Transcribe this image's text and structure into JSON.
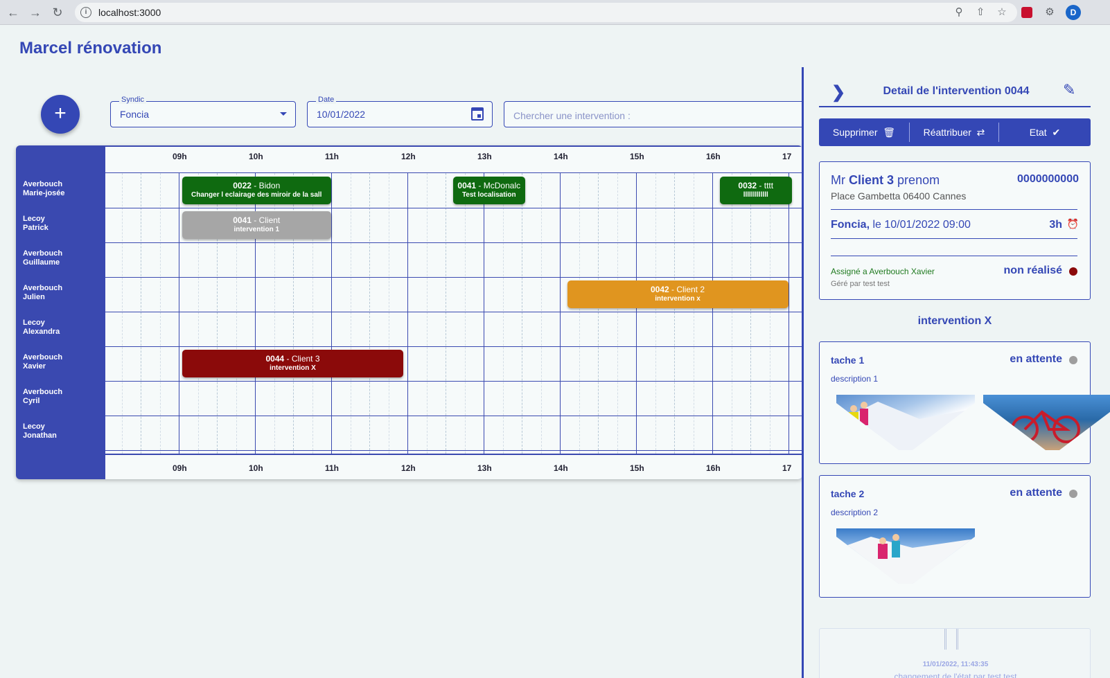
{
  "browser": {
    "url": "localhost:3000",
    "profile_initial": "D"
  },
  "app": {
    "title": "Marcel rénovation"
  },
  "filters": {
    "syndic_label": "Syndic",
    "syndic_value": "Foncia",
    "date_label": "Date",
    "date_value": "10/01/2022",
    "search_placeholder": "Chercher une intervention :"
  },
  "planning": {
    "hours": [
      "09h",
      "10h",
      "11h",
      "12h",
      "13h",
      "14h",
      "15h",
      "16h",
      "17"
    ],
    "rows": [
      {
        "last": "Averbouch",
        "first": "Marie-josée"
      },
      {
        "last": "Lecoy",
        "first": "Patrick"
      },
      {
        "last": "Averbouch",
        "first": "Guillaume"
      },
      {
        "last": "Averbouch",
        "first": "Julien"
      },
      {
        "last": "Lecoy",
        "first": "Alexandra"
      },
      {
        "last": "Averbouch",
        "first": "Xavier"
      },
      {
        "last": "Averbouch",
        "first": "Cyril"
      },
      {
        "last": "Lecoy",
        "first": "Jonathan"
      }
    ],
    "events": [
      {
        "num": "0022",
        "client": "Bidon",
        "desc": "Changer l eclairage des miroir de la sall",
        "row": 0,
        "start": 9.0,
        "end": 10.95,
        "color": "#0f6a10"
      },
      {
        "num": "0041",
        "client": "McDonalc",
        "desc": "Test localisation",
        "row": 0,
        "start": 12.55,
        "end": 13.5,
        "color": "#0f6a10"
      },
      {
        "num": "0032",
        "client": "tttt",
        "desc": "lllllllllllll",
        "row": 0,
        "start": 16.05,
        "end": 17.0,
        "color": "#0f6a10"
      },
      {
        "num": "0041",
        "client": "Client",
        "desc": "intervention 1",
        "row": 1,
        "start": 9.0,
        "end": 10.95,
        "color": "#a6a6a6"
      },
      {
        "num": "0042",
        "client": "Client 2",
        "desc": "intervention x",
        "row": 3,
        "start": 14.05,
        "end": 16.95,
        "color": "#e0951f"
      },
      {
        "num": "0044",
        "client": "Client 3",
        "desc": "intervention X",
        "row": 5,
        "start": 9.0,
        "end": 11.9,
        "color": "#8b0a0a"
      }
    ]
  },
  "panel": {
    "title": "Detail de l'intervention 0044",
    "actions": {
      "delete": "Supprimer",
      "reassign": "Réattribuer",
      "state": "Etat"
    },
    "client": {
      "civility": "Mr",
      "name": "Client 3",
      "firstname": "prenom",
      "phone": "0000000000",
      "address": "Place Gambetta 06400 Cannes",
      "syndic": "Foncia,",
      "date_text": "le 10/01/2022 09:00",
      "duration": "3h",
      "assigned": "Assigné a Averbouch Xavier",
      "managed_by": "Géré par test test",
      "status": "non réalisé",
      "status_color": "#8b0a0a"
    },
    "intervention_title": "intervention X",
    "tasks": [
      {
        "name": "tache 1",
        "state": "en attente",
        "desc": "description 1"
      },
      {
        "name": "tache 2",
        "state": "en attente",
        "desc": "description 2"
      }
    ],
    "history": {
      "timestamp": "11/01/2022, 11:43:35",
      "message": "changement de l'état par test test"
    }
  }
}
